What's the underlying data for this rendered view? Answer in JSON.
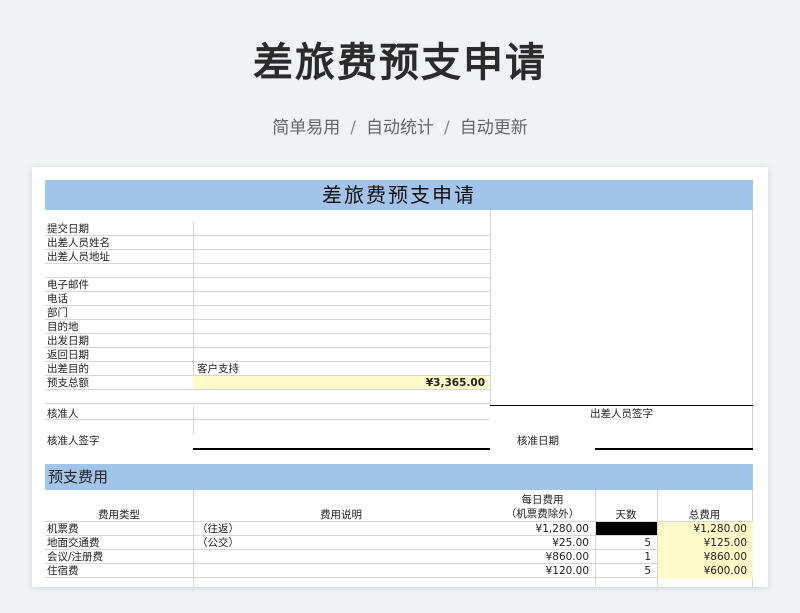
{
  "hero": {
    "title": "差旅费预支申请",
    "subtitle_1": "简单易用",
    "subtitle_2": "自动统计",
    "subtitle_3": "自动更新",
    "separator": "/"
  },
  "sheet": {
    "title": "差旅费预支申请",
    "fields": [
      {
        "label": "提交日期",
        "value": ""
      },
      {
        "label": "出差人员姓名",
        "value": ""
      },
      {
        "label": "出差人员地址",
        "value": ""
      },
      {
        "label": "",
        "value": ""
      },
      {
        "label": "电子邮件",
        "value": ""
      },
      {
        "label": "电话",
        "value": ""
      },
      {
        "label": "部门",
        "value": ""
      },
      {
        "label": "目的地",
        "value": ""
      },
      {
        "label": "出发日期",
        "value": ""
      },
      {
        "label": "返回日期",
        "value": ""
      },
      {
        "label": "出差目的",
        "value": "客户支持"
      }
    ],
    "advance_total_label": "预支总额",
    "advance_total_value": "¥3,365.00",
    "approver_label": "核准人",
    "traveler_sign_label": "出差人员签字",
    "approver_sign_label": "核准人签字",
    "approve_date_label": "核准日期",
    "section_title": "预支费用",
    "table": {
      "headers": {
        "type": "费用类型",
        "desc": "费用说明",
        "daily_1": "每日费用",
        "daily_2": "（机票费除外）",
        "days": "天数",
        "total": "总费用"
      },
      "rows": [
        {
          "type": "机票费",
          "desc": "（往返）",
          "daily": "¥1,280.00",
          "days": "",
          "total": "¥1,280.00"
        },
        {
          "type": "地面交通费",
          "desc": "（公交）",
          "daily": "¥25.00",
          "days": "5",
          "total": "¥125.00"
        },
        {
          "type": "会议/注册费",
          "desc": "",
          "daily": "¥860.00",
          "days": "1",
          "total": "¥860.00"
        },
        {
          "type": "住宿费",
          "desc": "",
          "daily": "¥120.00",
          "days": "5",
          "total": "¥600.00"
        }
      ]
    }
  }
}
